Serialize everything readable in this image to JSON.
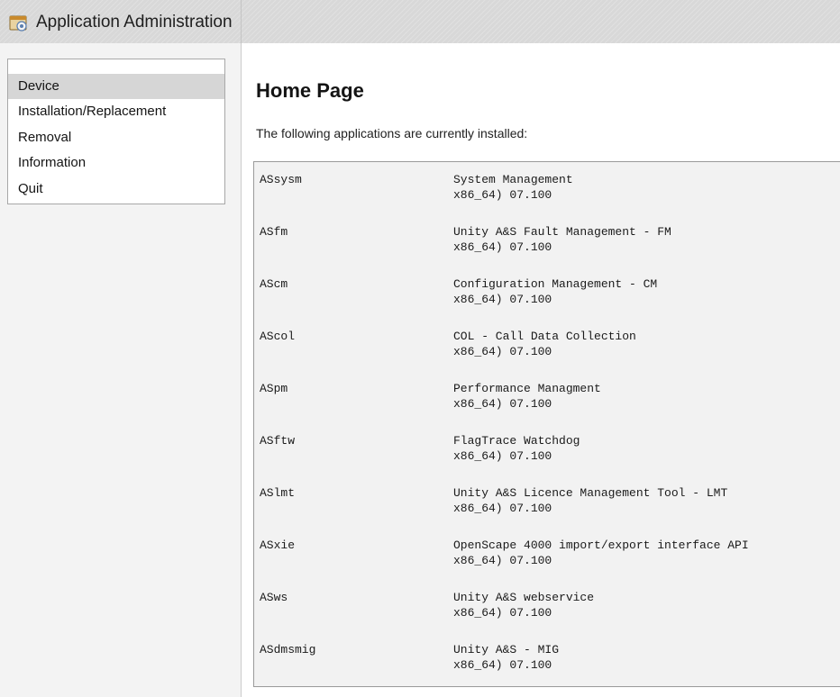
{
  "window": {
    "title": "Application Administration",
    "icon": "application-admin-icon"
  },
  "nav": {
    "items": [
      {
        "label": "Device",
        "selected": true
      },
      {
        "label": "Installation/Replacement",
        "selected": false
      },
      {
        "label": "Removal",
        "selected": false
      },
      {
        "label": "Information",
        "selected": false
      },
      {
        "label": "Quit",
        "selected": false
      }
    ]
  },
  "main": {
    "title": "Home Page",
    "intro": "The following applications are currently installed:",
    "applications": [
      {
        "code": "ASsysm",
        "name": "System Management",
        "version": "x86_64) 07.100"
      },
      {
        "code": "ASfm",
        "name": "Unity A&S Fault Management - FM",
        "version": "x86_64) 07.100"
      },
      {
        "code": "AScm",
        "name": "Configuration Management - CM",
        "version": "x86_64) 07.100"
      },
      {
        "code": "AScol",
        "name": "COL - Call Data Collection",
        "version": "x86_64) 07.100"
      },
      {
        "code": "ASpm",
        "name": "Performance Managment",
        "version": "x86_64) 07.100"
      },
      {
        "code": "ASftw",
        "name": "FlagTrace Watchdog",
        "version": "x86_64) 07.100"
      },
      {
        "code": "ASlmt",
        "name": "Unity A&S Licence Management Tool  - LMT",
        "version": "x86_64) 07.100"
      },
      {
        "code": "ASxie",
        "name": "OpenScape 4000 import/export interface API",
        "version": "x86_64) 07.100"
      },
      {
        "code": "ASws",
        "name": "Unity A&S webservice",
        "version": "x86_64) 07.100"
      },
      {
        "code": "ASdmsmig",
        "name": "Unity A&S - MIG",
        "version": "x86_64) 07.100"
      }
    ]
  },
  "colors": {
    "titlebar": "#d8d8d8",
    "sidebar": "#f3f3f3",
    "selected_item": "#d6d6d6",
    "app_list_background": "#f2f2f2"
  }
}
